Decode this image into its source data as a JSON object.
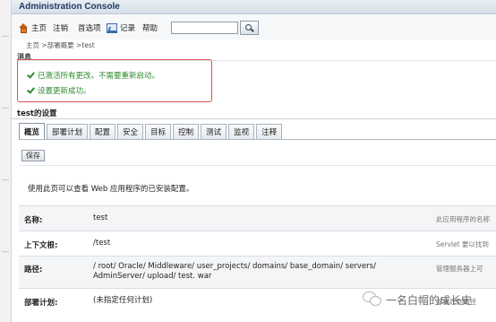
{
  "header": {
    "title": "Administration Console"
  },
  "nav": {
    "items": [
      {
        "label": "主页",
        "icon": "home-icon"
      },
      {
        "label": "注销"
      },
      {
        "label": "首选项"
      },
      {
        "label": "记录",
        "icon": "chart-icon"
      },
      {
        "label": "帮助"
      }
    ],
    "search_value": ""
  },
  "breadcrumb": "主页 >部署概要 >test",
  "messages": {
    "label": "消息",
    "items": [
      "已激活所有更改。不需要重新启动。",
      "设置更新成功。"
    ]
  },
  "settings": {
    "title": "test的设置",
    "tabs": [
      "概览",
      "部署计划",
      "配置",
      "安全",
      "目标",
      "控制",
      "测试",
      "监视",
      "注释"
    ],
    "active_tab": "概览",
    "save_label": "保存",
    "description": "使用此页可以查看 Web 应用程序的已安装配置。",
    "rows": [
      {
        "label": "名称:",
        "value": "test",
        "help": "此应用程序的名称"
      },
      {
        "label": "上下文根:",
        "value": "/test",
        "help": "Servlet 要以找到"
      },
      {
        "label": "路径:",
        "value": "/ root/ Oracle/ Middleware/ user_projects/ domains/ base_domain/ servers/ AdminServer/ upload/ test. war",
        "help": "管理服务器上可"
      },
      {
        "label": "部署计划:",
        "value": "(未指定任何计划)",
        "help": "部署计划路径"
      }
    ]
  },
  "watermark": {
    "text": "一名白帽的成长史"
  }
}
